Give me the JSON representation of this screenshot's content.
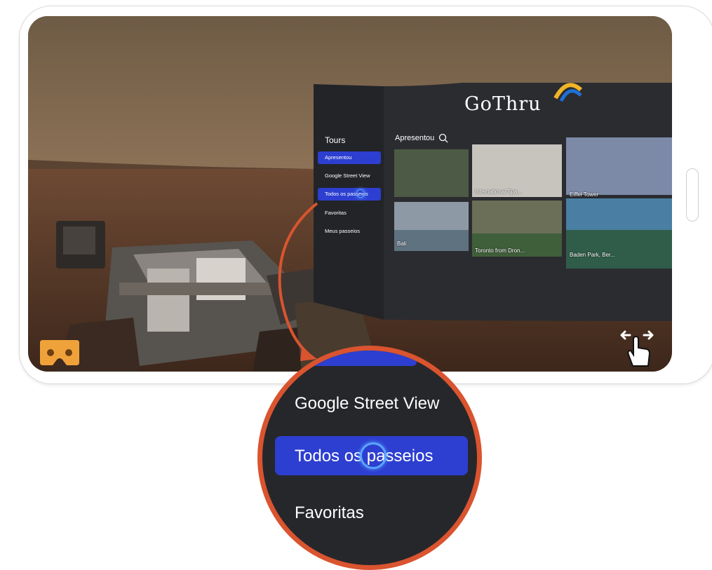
{
  "app": {
    "logo_text": "GoThru"
  },
  "sidebar": {
    "title": "Tours",
    "items": [
      {
        "label": "Apresentou",
        "active": true
      },
      {
        "label": "Google Street View",
        "active": false
      },
      {
        "label": "Todos os passeios",
        "active": true
      },
      {
        "label": "Favoritas",
        "active": false
      },
      {
        "label": "Meus passeios",
        "active": false
      }
    ]
  },
  "content": {
    "heading": "Apresentou",
    "search_icon": "search-icon",
    "thumbnails": [
      {
        "label": ""
      },
      {
        "label": "International Spa..."
      },
      {
        "label": "Eiffel Tower"
      },
      {
        "label": "Bali"
      },
      {
        "label": "Toronto from Dron..."
      },
      {
        "label": "Baden Park, Ber..."
      }
    ]
  },
  "zoom": {
    "items": [
      "Google Street View",
      "Todos os passeios",
      "Favoritas"
    ]
  },
  "icons": {
    "vr": "cardboard-vr-icon",
    "drag": "drag-pan-hand-icon"
  },
  "colors": {
    "accent_blue": "#2d3fd0",
    "highlight_orange": "#d9542f",
    "panel_dark": "#26272b"
  }
}
